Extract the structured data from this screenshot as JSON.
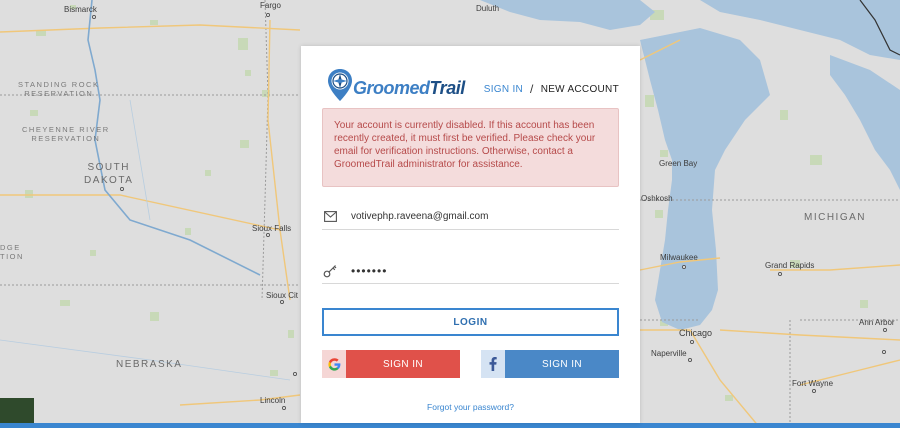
{
  "map": {
    "cities": {
      "bismarck": "Bismarck",
      "fargo": "Fargo",
      "duluth": "Duluth",
      "green_bay": "Green Bay",
      "oshkosh": "Oshkosh",
      "milwaukee": "Milwaukee",
      "grand_rapids": "Grand Rapids",
      "sioux_falls": "Sioux Falls",
      "sioux_city": "Sioux Cit",
      "chicago": "Chicago",
      "naperville": "Naperville",
      "ann_arbor": "Ann Arbor",
      "fort_wayne": "Fort Wayne",
      "lincoln": "Lincoln"
    },
    "states": {
      "south_dakota": "SOUTH\nDAKOTA",
      "nebraska": "NEBRASKA",
      "michigan": "MICHIGAN"
    },
    "reservations": {
      "standing_rock": "STANDING ROCK\nRESERVATION",
      "cheyenne_river": "CHEYENNE RIVER\nRESERVATION",
      "edge_partial": "DGE\nTION"
    }
  },
  "logo": {
    "part1": "Groomed",
    "part2": "Trail"
  },
  "nav": {
    "sign_in": "SIGN IN",
    "separator": "/",
    "new_account": "NEW ACCOUNT"
  },
  "alert": {
    "message": "Your account is currently disabled. If this account has been recently created, it must first be verified. Please check your email for verification instructions. Otherwise, contact a GroomedTrail administrator for assistance."
  },
  "form": {
    "email_value": "votivephp.raveena@gmail.com",
    "password_value": "•••••••",
    "login_label": "LOGIN",
    "google_label": "SIGN IN",
    "facebook_label": "SIGN IN",
    "forgot_label": "Forgot your password?"
  },
  "colors": {
    "accent": "#3a86d0",
    "alert_bg": "#f4dcdc",
    "alert_text": "#b64a4a",
    "google": "#e0514a",
    "facebook": "#4a88c7"
  }
}
